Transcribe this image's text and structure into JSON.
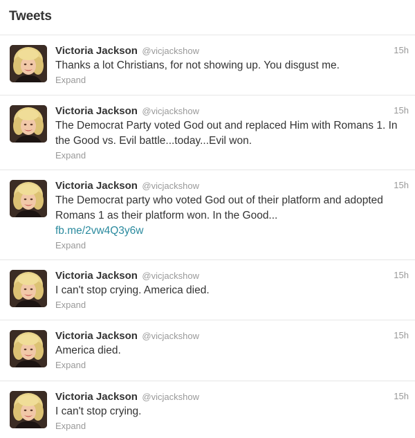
{
  "header": {
    "title": "Tweets"
  },
  "tweets": [
    {
      "name": "Victoria Jackson",
      "handle": "@vicjackshow",
      "time": "15h",
      "text": "Thanks a lot Christians, for not showing up. You disgust me.",
      "link": "",
      "expand": "Expand"
    },
    {
      "name": "Victoria Jackson",
      "handle": "@vicjackshow",
      "time": "15h",
      "text": "The Democrat Party voted God out and replaced Him with Romans 1. In the Good vs. Evil battle...today...Evil won.",
      "link": "",
      "expand": "Expand"
    },
    {
      "name": "Victoria Jackson",
      "handle": "@vicjackshow",
      "time": "15h",
      "text": "The Democrat party who voted God out of their platform and adopted Romans 1 as their platform won. In the Good...",
      "link": "fb.me/2vw4Q3y6w",
      "expand": "Expand"
    },
    {
      "name": "Victoria Jackson",
      "handle": "@vicjackshow",
      "time": "15h",
      "text": "I can't stop crying. America died.",
      "link": "",
      "expand": "Expand"
    },
    {
      "name": "Victoria Jackson",
      "handle": "@vicjackshow",
      "time": "15h",
      "text": "America died.",
      "link": "",
      "expand": "Expand"
    },
    {
      "name": "Victoria Jackson",
      "handle": "@vicjackshow",
      "time": "15h",
      "text": "I can't stop crying.",
      "link": "",
      "expand": "Expand"
    }
  ]
}
